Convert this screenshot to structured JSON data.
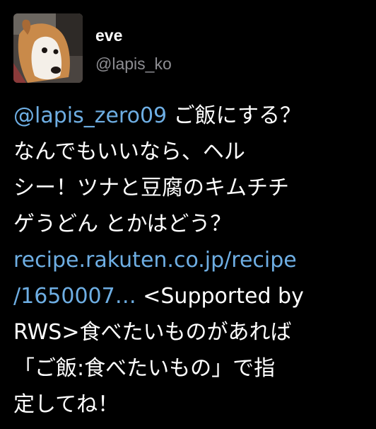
{
  "user": {
    "display_name": "eve",
    "handle": "@lapis_ko",
    "avatar_icon": "dog-avatar-icon"
  },
  "tweet": {
    "mention": "@lapis_zero09",
    "line1_rest": " ご飯にする？",
    "line2": "なんでもいいなら、ヘル",
    "line3": "シー！ツナと豆腐のキムチチ",
    "line4": "ゲうどん とかはどう？",
    "link_line1": "recipe.rakuten.co.jp/recipe",
    "link_line2": "/1650007…",
    "line6_rest": " <Supported by",
    "line7": "RWS>食べたいものがあれば",
    "line8": "「ご飯:食べたいもの」で指",
    "line9": "定してね！"
  },
  "colors": {
    "background": "#000000",
    "text": "#ffffff",
    "handle": "#8e8e93",
    "link": "#6eaee3"
  }
}
